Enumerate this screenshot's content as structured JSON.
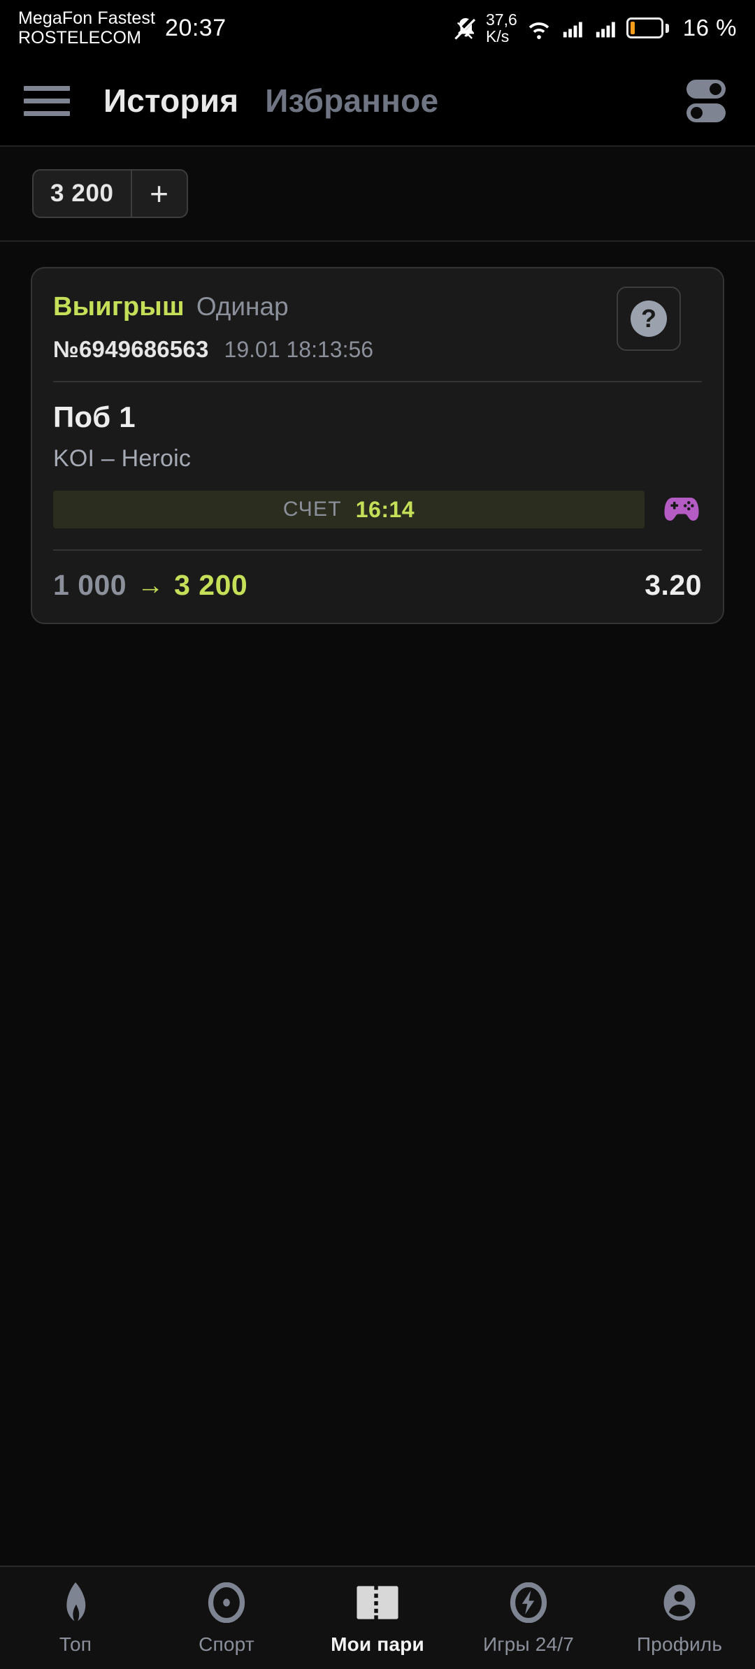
{
  "statusbar": {
    "carrier_line1": "MegaFon Fastest",
    "carrier_line2": "ROSTELECOM",
    "clock": "20:37",
    "netspeed_value": "37,6",
    "netspeed_unit": "K/s",
    "battery_percent": "16 %",
    "battery_level": 16,
    "icons": {
      "mute": "bell-muted-icon",
      "wifi": "wifi-icon",
      "signal1": "cellular-signal-icon",
      "signal2": "cellular-signal-icon",
      "battery": "battery-icon"
    }
  },
  "header": {
    "menu_icon": "hamburger-menu-icon",
    "tabs": [
      {
        "label": "История",
        "active": true
      },
      {
        "label": "Избранное",
        "active": false
      }
    ],
    "filter_icon": "toggles-filter-icon"
  },
  "balance": {
    "amount": "3 200",
    "deposit_label": "+"
  },
  "bet": {
    "status": "Выигрыш",
    "type": "Одинар",
    "id": "№6949686563",
    "date": "19.01 18:13:56",
    "help_glyph": "?",
    "pick": "Поб 1",
    "match": "KOI – Heroic",
    "score_label": "СЧЕТ",
    "score_value": "16:14",
    "sport_icon": "gamepad-icon",
    "stake": "1 000",
    "arrow": "→",
    "payout": "3 200",
    "odds": "3.20",
    "colors": {
      "win_green": "#c5e058",
      "muted": "#8b909b",
      "card_bg": "#1a1a1a",
      "score_bar_bg": "#2b2e1e",
      "sport_icon": "#b45bc4"
    }
  },
  "bottomnav": {
    "items": [
      {
        "label": "Топ",
        "icon": "flame-icon",
        "active": false
      },
      {
        "label": "Спорт",
        "icon": "target-ball-icon",
        "active": false
      },
      {
        "label": "Мои пари",
        "icon": "ticket-icon",
        "active": true
      },
      {
        "label": "Игры 24/7",
        "icon": "lightning-bolt-icon",
        "active": false
      },
      {
        "label": "Профиль",
        "icon": "person-icon",
        "active": false
      }
    ]
  }
}
